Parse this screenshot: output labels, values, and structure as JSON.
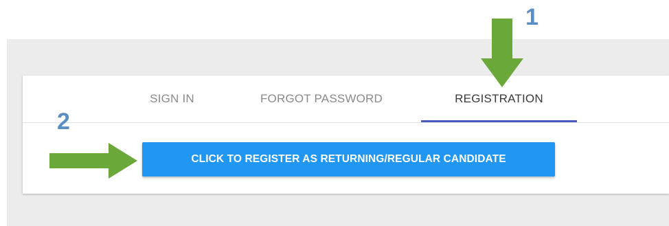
{
  "tabs": {
    "sign_in": "SIGN IN",
    "forgot_password": "FORGOT PASSWORD",
    "registration": "REGISTRATION",
    "active": "REGISTRATION"
  },
  "main": {
    "register_button_label": "CLICK TO REGISTER AS RETURNING/REGULAR CANDIDATE"
  },
  "annotations": {
    "step_1": "1",
    "step_2": "2",
    "arrow_icon": "green-arrow-icon"
  },
  "colors": {
    "button": "#2196f3",
    "active_tab_indicator": "#4a5bbf",
    "annotation_arrow": "#6aa83a",
    "annotation_number": "#5b8fc4"
  }
}
